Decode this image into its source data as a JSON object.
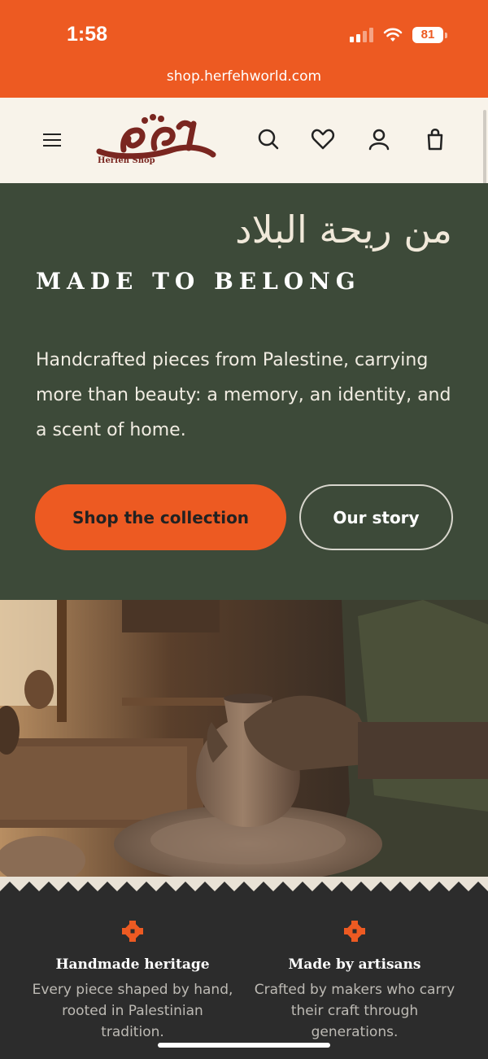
{
  "status_bar": {
    "time": "1:58",
    "battery": "81",
    "url": "shop.herfehworld.com"
  },
  "header": {
    "logo_text": "Herfeh Shop",
    "icons": [
      "menu-icon",
      "search-icon",
      "heart-icon",
      "account-icon",
      "bag-icon"
    ]
  },
  "hero": {
    "arabic_title": "من ريحة البلاد",
    "title": "MADE TO BELONG",
    "description": "Handcrafted pieces from Palestine, carrying more than beauty: a memory, an identity, and a scent of home.",
    "primary_button": "Shop the collection",
    "secondary_button": "Our story"
  },
  "features": [
    {
      "title": "Handmade heritage",
      "description": "Every piece shaped by hand, rooted in Palestinian tradition."
    },
    {
      "title": "Made by artisans",
      "description": "Crafted by makers who carry their craft through generations."
    }
  ],
  "colors": {
    "accent": "#ed5a22",
    "hero_green": "#3d4a39",
    "header_cream": "#f8f3ea",
    "logo_maroon": "#7a2620",
    "features_bg": "#2c2c2c"
  }
}
